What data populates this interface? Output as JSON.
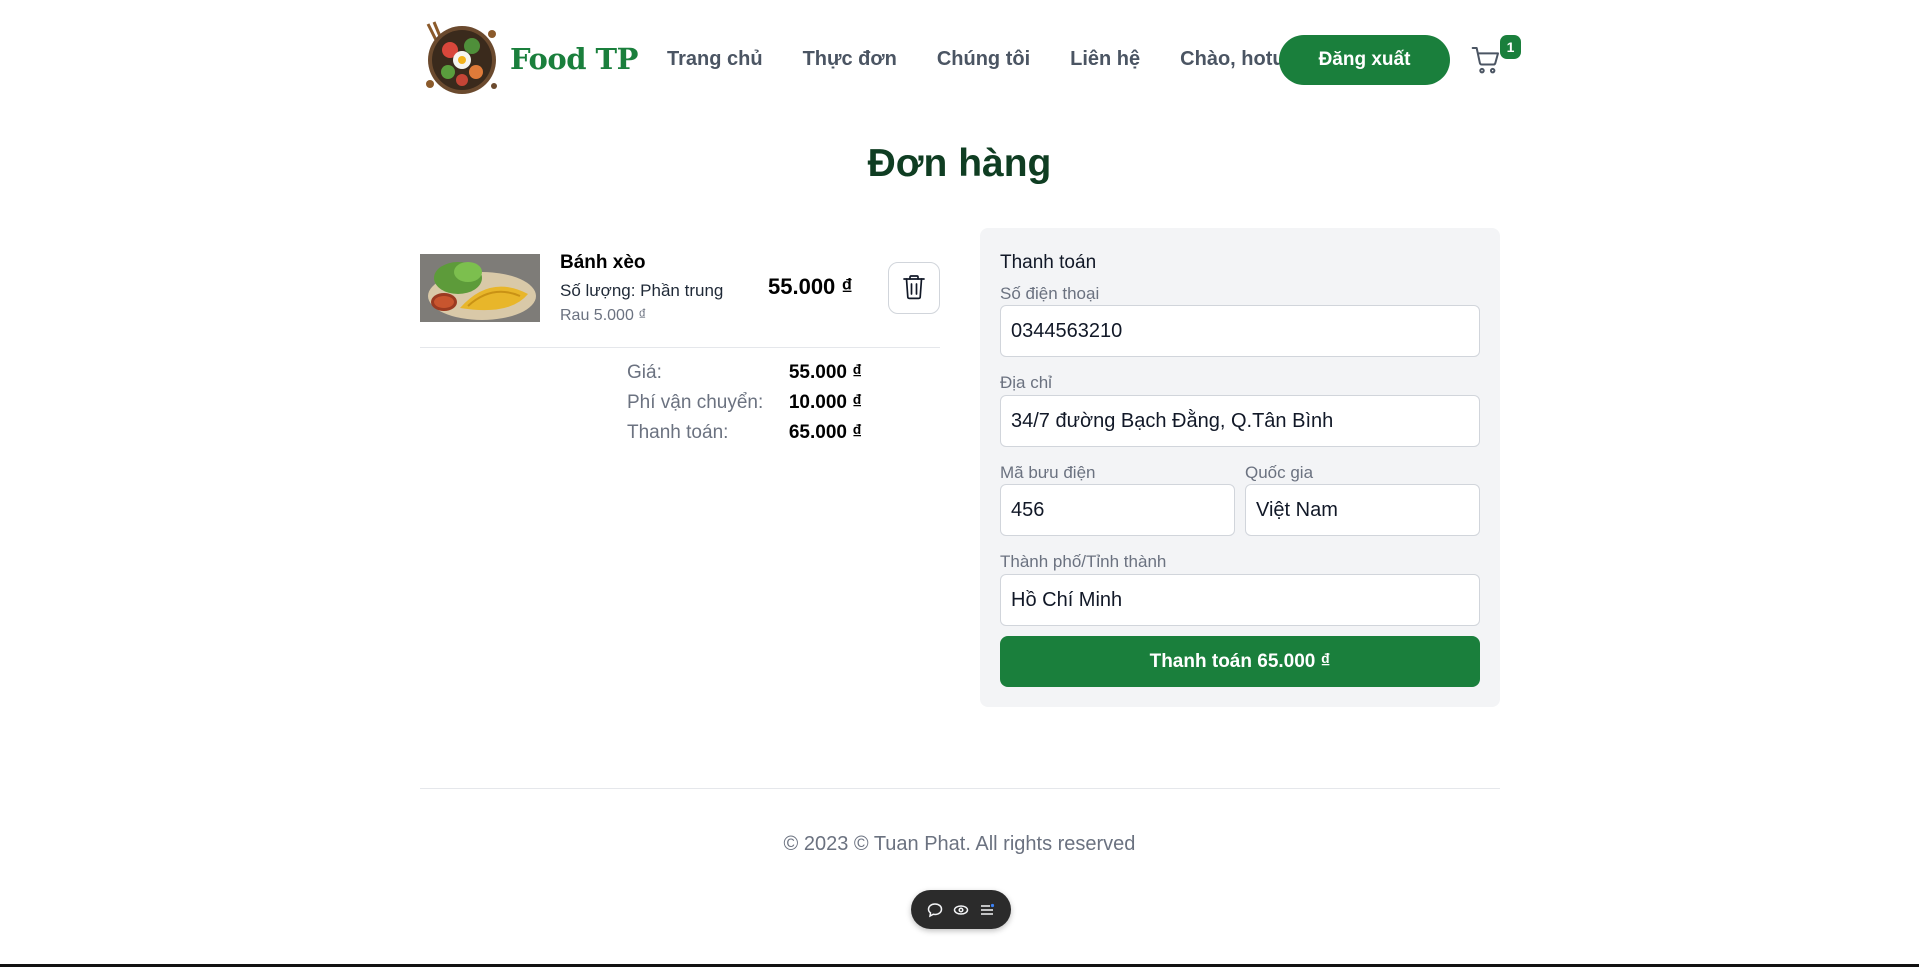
{
  "brand": {
    "name": "Food TP"
  },
  "nav": {
    "items": [
      "Trang chủ",
      "Thực đơn",
      "Chúng tôi",
      "Liên hệ"
    ],
    "greeting": "Chào, hotu...",
    "logout_label": "Đăng xuất",
    "cart_count": "1"
  },
  "page": {
    "title": "Đơn hàng"
  },
  "order": {
    "item": {
      "name": "Bánh xèo",
      "quantity": "Số lượng: Phần trung",
      "option": "Rau 5.000 ₫",
      "price": "55.000 ₫"
    },
    "summary": [
      {
        "label": "Giá:",
        "value": "55.000 ₫"
      },
      {
        "label": "Phí vận chuyển:",
        "value": "10.000 ₫"
      },
      {
        "label": "Thanh toán:",
        "value": "65.000 ₫"
      }
    ]
  },
  "payment": {
    "title": "Thanh toán",
    "phone": {
      "label": "Số điện thoại",
      "value": "0344563210"
    },
    "address": {
      "label": "Địa chỉ",
      "value": "34/7 đường Bạch Đằng, Q.Tân Bình"
    },
    "postal": {
      "label": "Mã bưu điện",
      "value": "456"
    },
    "country": {
      "label": "Quốc gia",
      "value": "Việt Nam"
    },
    "city": {
      "label": "Thành phố/Tỉnh thành",
      "value": "Hồ Chí Minh"
    },
    "submit_label": "Thanh toán 65.000 ₫"
  },
  "footer": {
    "copyright": "© 2023 © Tuan Phat. All rights reserved"
  },
  "colors": {
    "brand_green": "#1a7f3c",
    "title_green": "#0f3d22",
    "panel_bg": "#f3f4f6"
  },
  "icons": {
    "cart": "shopping-cart-icon",
    "delete": "trash-icon",
    "toolbar": [
      "chat-icon",
      "eye-icon",
      "menu-icon"
    ]
  }
}
